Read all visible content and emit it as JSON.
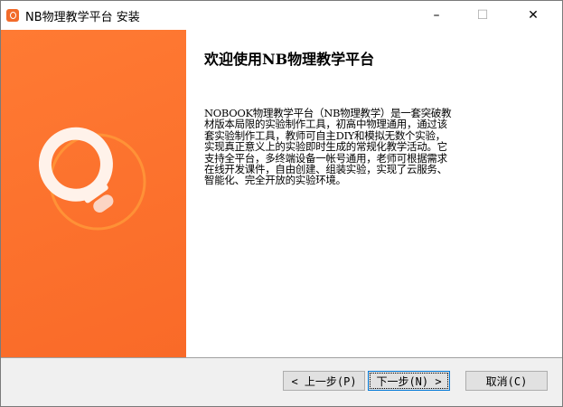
{
  "window": {
    "title": "NB物理教学平台 安装",
    "minimize": "–",
    "maximize": "☐",
    "close": "✕"
  },
  "main": {
    "heading": "欢迎使用NB物理教学平台",
    "paragraph_lines": [
      "    NOBOOK物理教学平台（NB物理教学）是一套突破教",
      "材版本局限的实验制作工具，初高中物理通用，通过该",
      "套实验制作工具，教师可自主DIY和模拟无数个实验，",
      "实现真正意义上的实验即时生成的常规化教学活动。它",
      "支持全平台，多终端设备一帐号通用，老师可根据需求",
      "在线开发课件，自由创建、组装实验，实现了云服务、",
      "智能化、完全开放的实验环境。"
    ]
  },
  "buttons": {
    "back": "< 上一步(P)",
    "next": "下一步(N) >",
    "cancel": "取消(C)"
  },
  "colors": {
    "brand": "#f96a28"
  }
}
